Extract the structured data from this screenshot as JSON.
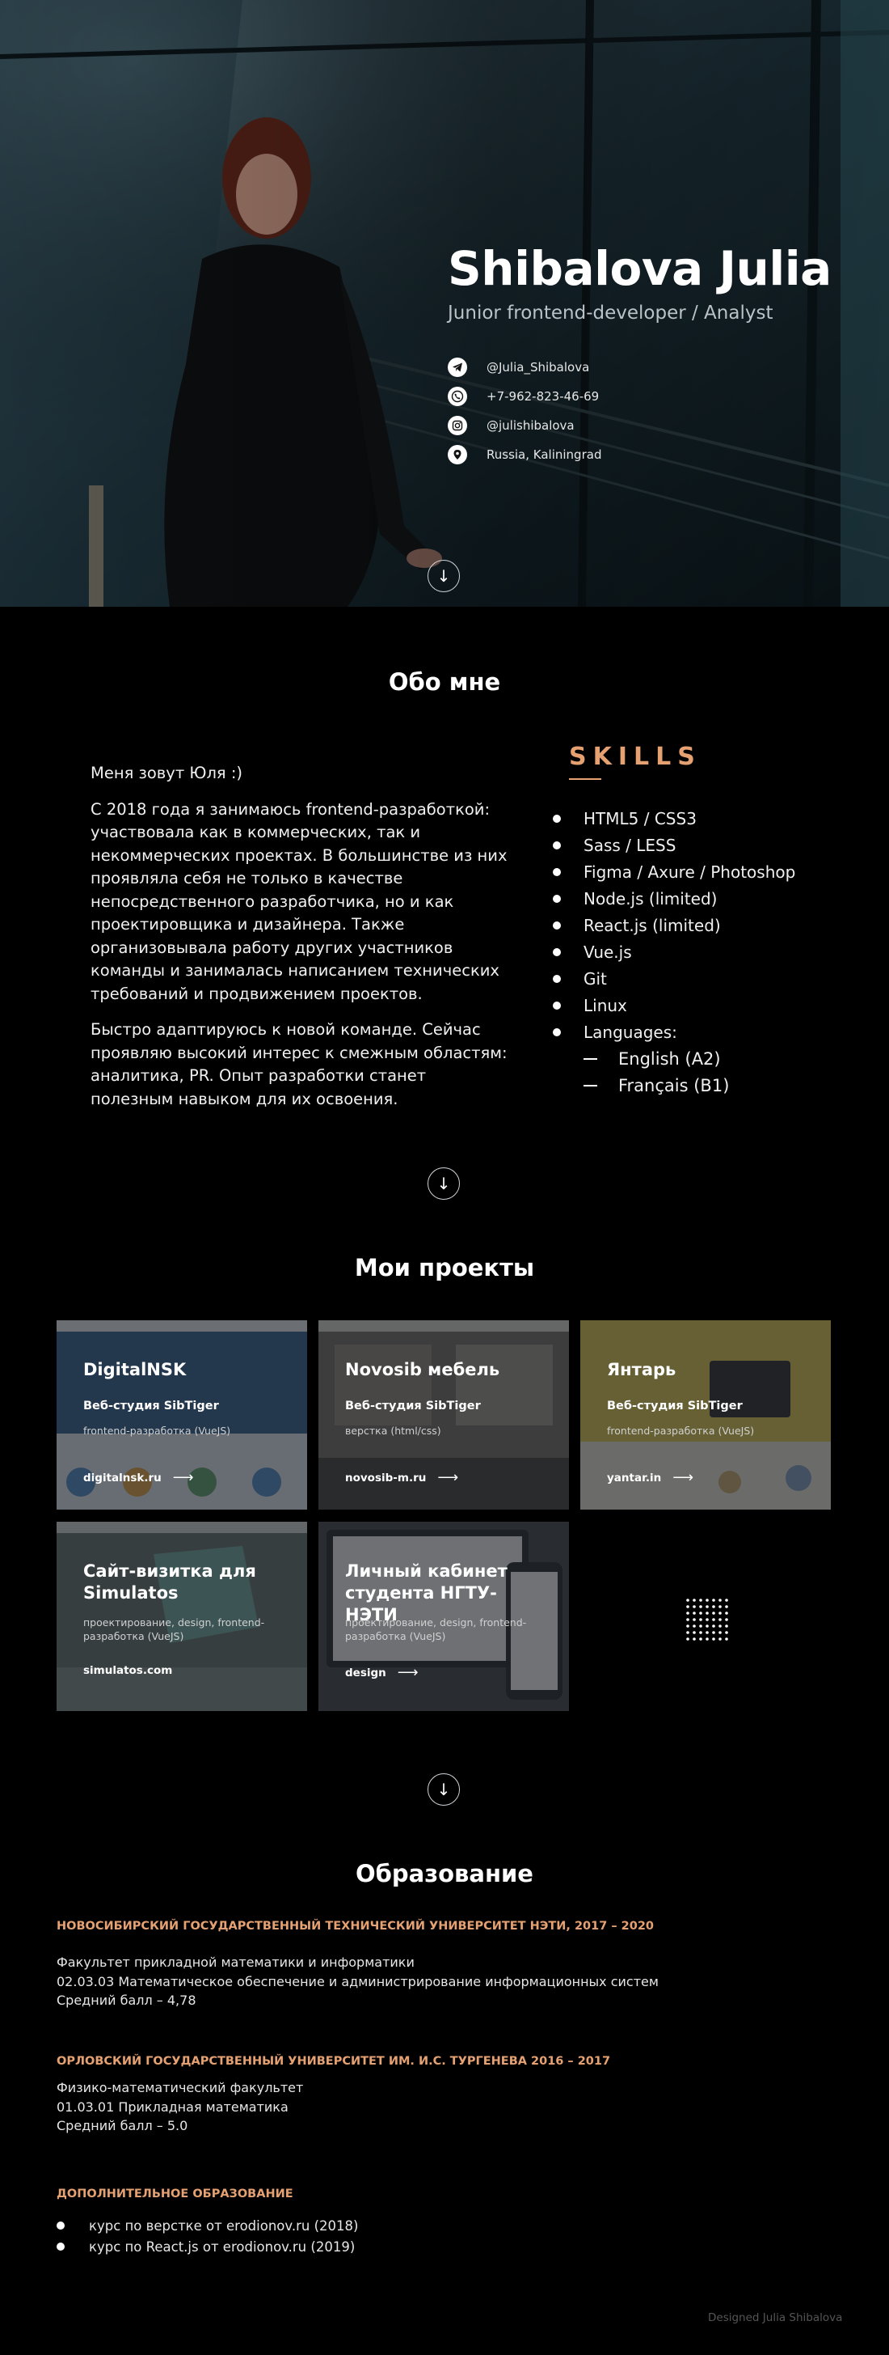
{
  "hero": {
    "name": "Shibalova Julia",
    "role": "Junior frontend-developer / Analyst",
    "contacts": [
      {
        "icon": "telegram-icon",
        "text": "@Julia_Shibalova"
      },
      {
        "icon": "phone-icon",
        "text": "+7-962-823-46-69"
      },
      {
        "icon": "instagram-icon",
        "text": "@julishibalova"
      },
      {
        "icon": "location-icon",
        "text": "Russia, Kaliningrad"
      }
    ],
    "scroll_glyph": "↓"
  },
  "about": {
    "title": "Обо мне",
    "paragraphs": [
      "Меня зовут Юля :)",
      "С 2018 года я занимаюсь frontend-разработкой: участвовала как в коммерческих, так и некоммерческих проектах. В большинстве из них проявляла себя не только в качестве непосредственного разработчика, но и как проектировщика и дизайнера. Также организовывала работу других участников команды и занималась написанием технических требований и продвижением проектов.",
      "Быстро адаптируюсь к новой команде. Сейчас проявляю высокий интерес к смежным областям: аналитика, PR. Опыт разработки станет полезным навыком для их освоения."
    ],
    "skills_title": "SKILLS",
    "skills": [
      "HTML5 / CSS3",
      "Sass / LESS",
      "Figma / Axure / Photoshop",
      "Node.js (limited)",
      "React.js (limited)",
      "Vue.js",
      "Git",
      "Linux",
      "Languages:"
    ],
    "languages": [
      "English (A2)",
      "Français (B1)"
    ],
    "scroll_glyph": "↓"
  },
  "projects": {
    "title": "Мои проекты",
    "items": [
      {
        "title": "DigitalNSK",
        "studio": "Веб-студия SibTiger",
        "desc": "frontend-разработка (VueJS)",
        "link": "digitalnsk.ru",
        "arrow": "⟶"
      },
      {
        "title": "Novosib мебель",
        "studio": "Веб-студия SibTiger",
        "desc": "верстка (html/css)",
        "link": "novosib-m.ru",
        "arrow": "⟶"
      },
      {
        "title": "Янтарь",
        "studio": "Веб-студия SibTiger",
        "desc": "frontend-разработка (VueJS)",
        "link": "yantar.in",
        "arrow": "⟶"
      },
      {
        "title": "Сайт-визитка для Simulatos",
        "studio": "",
        "desc": "проектирование, design, frontend-разработка (VueJS)",
        "link": "simulatos.com",
        "arrow": ""
      },
      {
        "title": "Личный кабинет студента НГТУ-НЭТИ",
        "studio": "",
        "desc": "проектирование, design, frontend-разработка (VueJS)",
        "link": "design",
        "arrow": "⟶"
      }
    ],
    "scroll_glyph": "↓"
  },
  "education": {
    "title": "Образование",
    "entries": [
      {
        "head": "НОВОСИБИРСКИЙ ГОСУДАРСТВЕННЫЙ ТЕХНИЧЕСКИЙ УНИВЕРСИТЕТ НЭТИ, 2017 – 2020",
        "lines": [
          "Факультет прикладной математики и информатики",
          "02.03.03 Математическое обеспечение и администрирование информационных систем",
          "Средний балл – 4,78"
        ]
      },
      {
        "head": "ОРЛОВСКИЙ ГОСУДАРСТВЕННЫЙ УНИВЕРСИТЕТ ИМ. И.С. ТУРГЕНЕВА 2016 – 2017",
        "lines": [
          "Физико-математический факультет",
          "01.03.01 Прикладная математика",
          "Средний балл – 5.0"
        ]
      }
    ],
    "extra_head": "ДОПОЛНИТЕЛЬНОЕ ОБРАЗОВАНИЕ",
    "courses": [
      "курс по верстке от erodionov.ru (2018)",
      "курс по React.js от erodionov.ru (2019)"
    ]
  },
  "footer": {
    "text": "Designed Julia Shibalova"
  }
}
